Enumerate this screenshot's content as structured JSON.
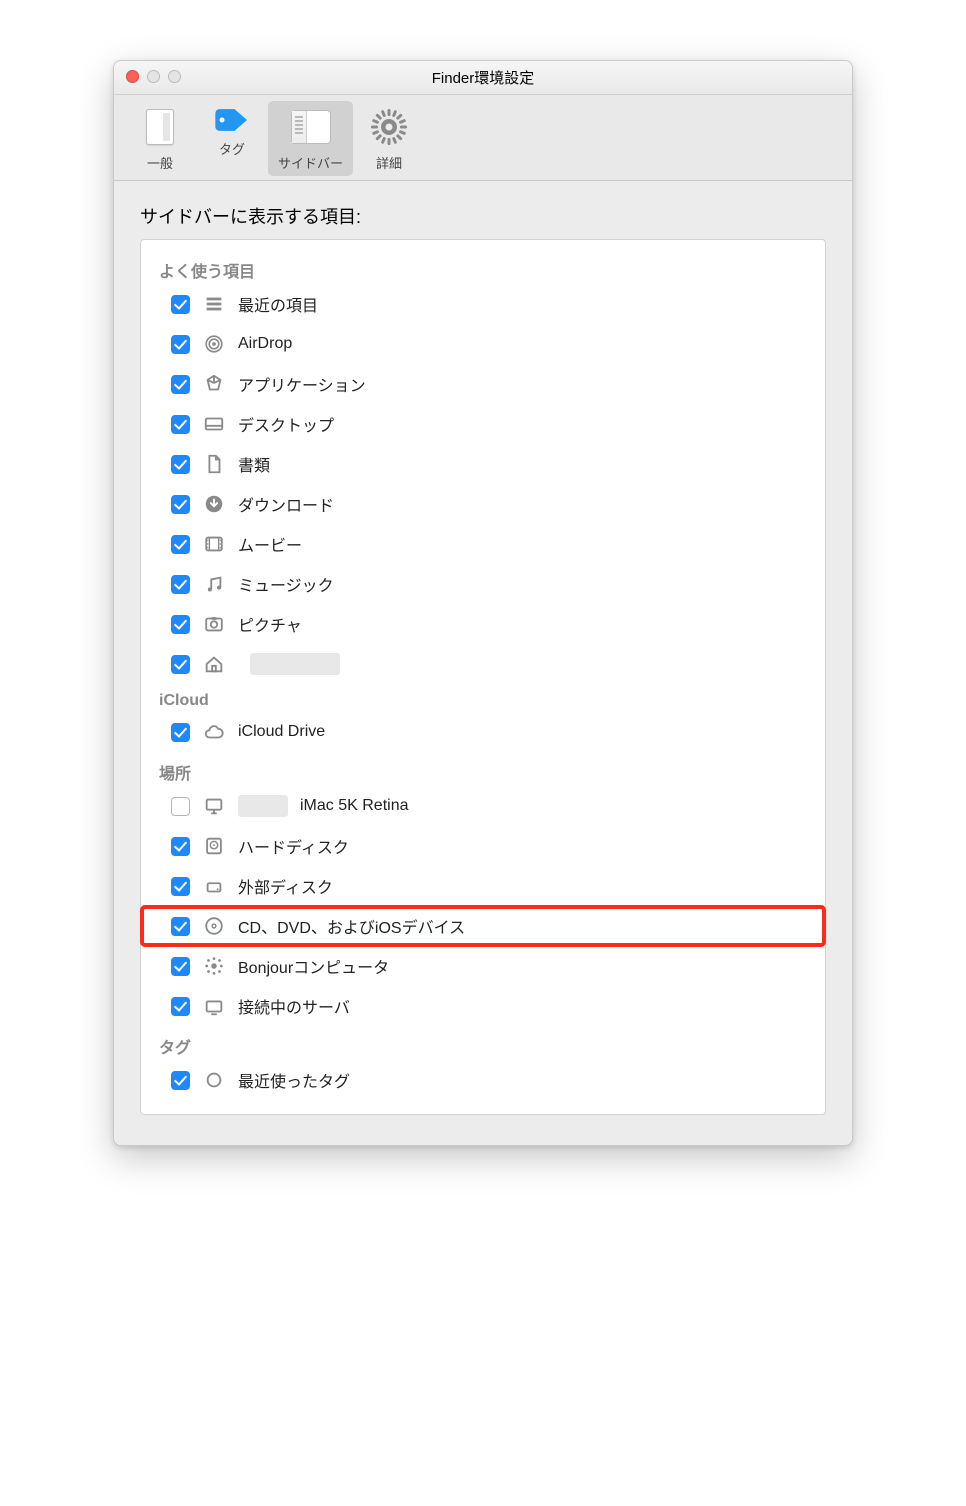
{
  "window": {
    "title": "Finder環境設定"
  },
  "toolbar": {
    "items": [
      {
        "label": "一般",
        "icon": "general-icon"
      },
      {
        "label": "タグ",
        "icon": "tag-icon"
      },
      {
        "label": "サイドバー",
        "icon": "sidebar-icon"
      },
      {
        "label": "詳細",
        "icon": "gear-icon"
      }
    ],
    "selected": "サイドバー"
  },
  "main": {
    "heading": "サイドバーに表示する項目:",
    "groups": [
      {
        "title": "よく使う項目",
        "items": [
          {
            "label": "最近の項目",
            "icon": "recents-icon",
            "checked": true
          },
          {
            "label": "AirDrop",
            "icon": "airdrop-icon",
            "checked": true
          },
          {
            "label": "アプリケーション",
            "icon": "applications-icon",
            "checked": true
          },
          {
            "label": "デスクトップ",
            "icon": "desktop-icon",
            "checked": true
          },
          {
            "label": "書類",
            "icon": "documents-icon",
            "checked": true
          },
          {
            "label": "ダウンロード",
            "icon": "download-icon",
            "checked": true
          },
          {
            "label": "ムービー",
            "icon": "movies-icon",
            "checked": true
          },
          {
            "label": "ミュージック",
            "icon": "music-icon",
            "checked": true
          },
          {
            "label": "ピクチャ",
            "icon": "pictures-icon",
            "checked": true
          },
          {
            "label": "",
            "icon": "home-icon",
            "checked": true,
            "obscured": true
          }
        ]
      },
      {
        "title": "iCloud",
        "items": [
          {
            "label": "iCloud Drive",
            "icon": "cloud-icon",
            "checked": true
          }
        ]
      },
      {
        "title": "場所",
        "items": [
          {
            "label": "iMac 5K Retina",
            "icon": "imac-icon",
            "checked": false,
            "obscured_prefix": true
          },
          {
            "label": "ハードディスク",
            "icon": "harddisk-icon",
            "checked": true
          },
          {
            "label": "外部ディスク",
            "icon": "external-icon",
            "checked": true
          },
          {
            "label": "CD、DVD、およびiOSデバイス",
            "icon": "disc-icon",
            "checked": true,
            "highlight": true
          },
          {
            "label": "Bonjourコンピュータ",
            "icon": "bonjour-icon",
            "checked": true
          },
          {
            "label": "接続中のサーバ",
            "icon": "server-icon",
            "checked": true
          }
        ]
      },
      {
        "title": "タグ",
        "items": [
          {
            "label": "最近使ったタグ",
            "icon": "tag-outline-icon",
            "checked": true
          }
        ]
      }
    ]
  }
}
